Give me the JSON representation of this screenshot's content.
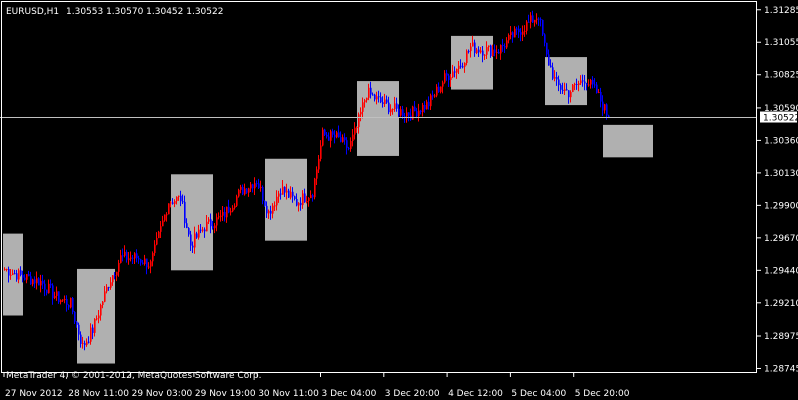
{
  "header": {
    "symbol_timeframe": "EURUSD,H1",
    "ohlc": "1.30553 1.30570 1.30452 1.30522"
  },
  "copyright": "MetaTrader 4, © 2001-2012, MetaQuotes Software Corp.",
  "colors": {
    "background": "#000000",
    "frame": "#ffffff",
    "bull": "#ff0000",
    "bear": "#0000ff",
    "box": "#b0b0b0",
    "bid_line": "#c0c0c0"
  },
  "chart_data": {
    "type": "candlestick",
    "symbol": "EURUSD",
    "timeframe": "H1",
    "last_price": 1.30522,
    "ylim": [
      1.2872,
      1.3134
    ],
    "y_ticks": [
      "1.31285",
      "1.31055",
      "1.30825",
      "1.30590",
      "1.30360",
      "1.30130",
      "1.29900",
      "1.29670",
      "1.29440",
      "1.29210",
      "1.28975",
      "1.28745"
    ],
    "x_ticks": [
      "27 Nov 2012",
      "28 Nov 11:00",
      "29 Nov 03:00",
      "29 Nov 19:00",
      "30 Nov 11:00",
      "3 Dec 04:00",
      "3 Dec 20:00",
      "4 Dec 12:00",
      "5 Dec 04:00",
      "5 Dec 20:00"
    ],
    "boxes": [
      {
        "start": 0,
        "end": 9,
        "high": 1.297,
        "low": 1.2912
      },
      {
        "start": 37,
        "end": 55,
        "high": 1.2945,
        "low": 1.2878
      },
      {
        "start": 84,
        "end": 104,
        "high": 1.3012,
        "low": 1.2944
      },
      {
        "start": 131,
        "end": 151,
        "high": 1.3023,
        "low": 1.2965
      },
      {
        "start": 177,
        "end": 197,
        "high": 1.3078,
        "low": 1.3025
      },
      {
        "start": 224,
        "end": 244,
        "high": 1.311,
        "low": 1.3072
      },
      {
        "start": 271,
        "end": 291,
        "high": 1.3095,
        "low": 1.3061
      },
      {
        "start": 300,
        "end": 324,
        "high": 1.3047,
        "low": 1.3024
      }
    ],
    "anchors": [
      [
        0,
        1.2945
      ],
      [
        8,
        1.294
      ],
      [
        18,
        1.2936
      ],
      [
        26,
        1.2925
      ],
      [
        33,
        1.292
      ],
      [
        39,
        1.289
      ],
      [
        44,
        1.2902
      ],
      [
        52,
        1.2935
      ],
      [
        58,
        1.2953
      ],
      [
        66,
        1.2953
      ],
      [
        73,
        1.2948
      ],
      [
        82,
        1.2993
      ],
      [
        88,
        1.2995
      ],
      [
        93,
        1.2962
      ],
      [
        100,
        1.2975
      ],
      [
        109,
        1.2982
      ],
      [
        118,
        1.3
      ],
      [
        126,
        1.3008
      ],
      [
        132,
        1.2985
      ],
      [
        138,
        1.3002
      ],
      [
        146,
        1.2992
      ],
      [
        154,
        1.3
      ],
      [
        159,
        1.304
      ],
      [
        166,
        1.3038
      ],
      [
        172,
        1.303
      ],
      [
        176,
        1.3045
      ],
      [
        181,
        1.307
      ],
      [
        188,
        1.3063
      ],
      [
        196,
        1.3057
      ],
      [
        203,
        1.3055
      ],
      [
        212,
        1.3062
      ],
      [
        220,
        1.308
      ],
      [
        228,
        1.309
      ],
      [
        233,
        1.3102
      ],
      [
        240,
        1.31
      ],
      [
        247,
        1.31
      ],
      [
        254,
        1.311
      ],
      [
        261,
        1.3118
      ],
      [
        267,
        1.3125
      ],
      [
        271,
        1.3095
      ],
      [
        276,
        1.3075
      ],
      [
        282,
        1.307
      ],
      [
        290,
        1.308
      ],
      [
        296,
        1.307
      ],
      [
        302,
        1.3052
      ]
    ],
    "seed": 7,
    "total_bars": 303
  }
}
